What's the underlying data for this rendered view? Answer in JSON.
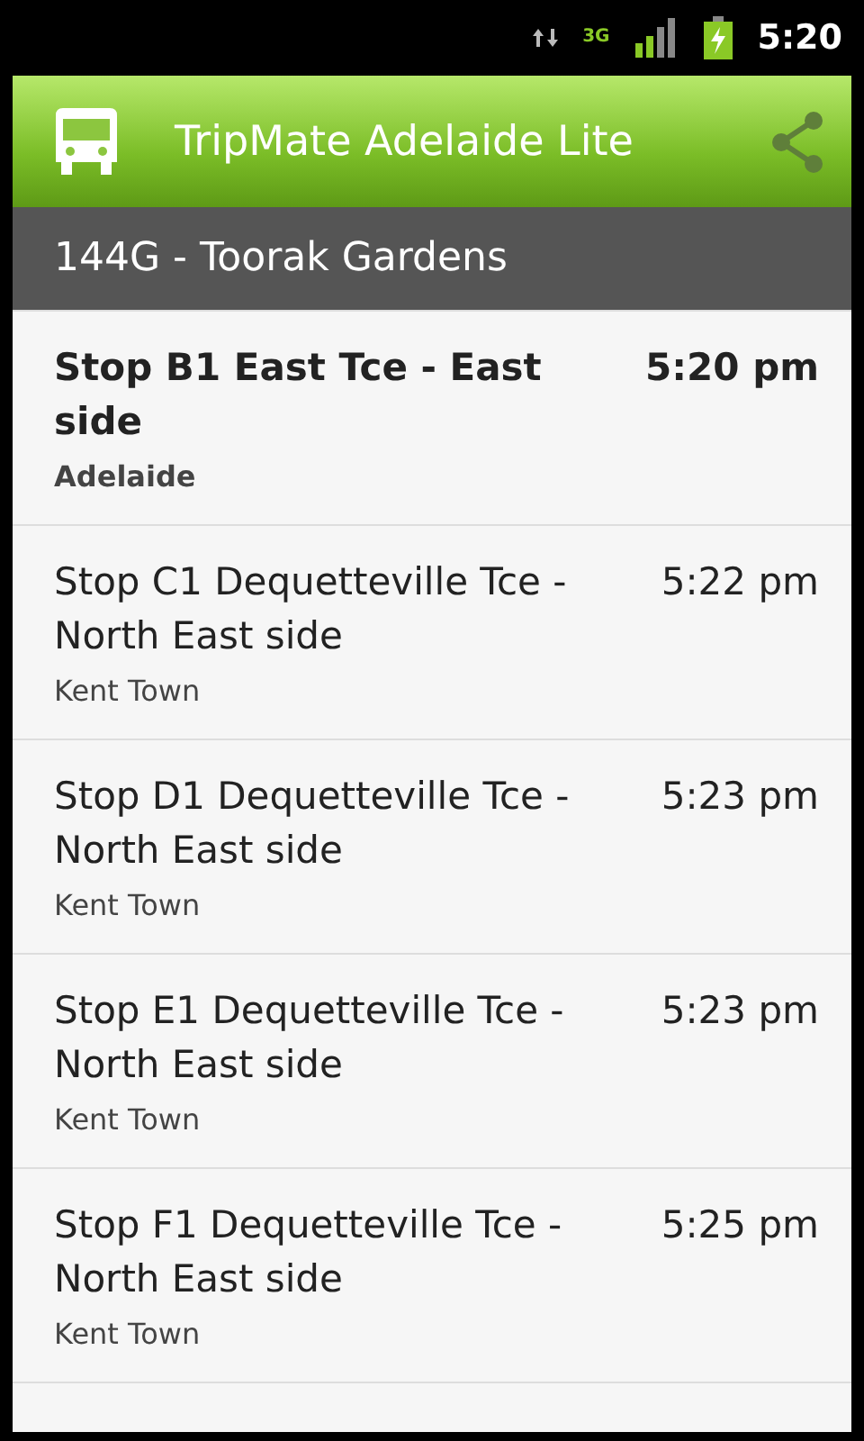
{
  "status_bar": {
    "network": "3G",
    "time": "5:20"
  },
  "app_bar": {
    "title": "TripMate Adelaide Lite"
  },
  "section": {
    "title": "144G - Toorak Gardens"
  },
  "stops": [
    {
      "name": "Stop B1 East Tce - East side",
      "suburb": "Adelaide",
      "time": "5:20 pm",
      "current": true
    },
    {
      "name": "Stop C1 Dequetteville Tce - North East side",
      "suburb": "Kent Town",
      "time": "5:22 pm",
      "current": false
    },
    {
      "name": "Stop D1 Dequetteville Tce - North East side",
      "suburb": "Kent Town",
      "time": "5:23 pm",
      "current": false
    },
    {
      "name": "Stop E1 Dequetteville Tce - North East side",
      "suburb": "Kent Town",
      "time": "5:23 pm",
      "current": false
    },
    {
      "name": "Stop F1 Dequetteville Tce - North East side",
      "suburb": "Kent Town",
      "time": "5:25 pm",
      "current": false
    }
  ]
}
